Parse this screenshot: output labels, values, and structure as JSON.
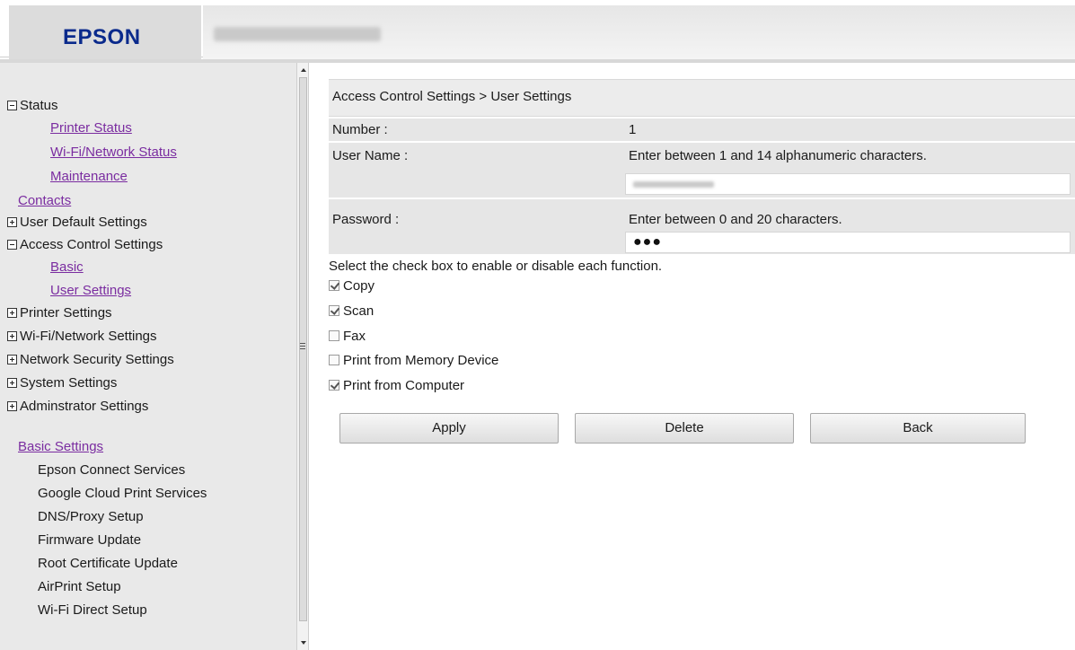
{
  "header": {
    "logo_text": "EPSON"
  },
  "sidebar": {
    "status": "Status",
    "printer_status": "Printer Status",
    "wifi_network_status": "Wi-Fi/Network Status",
    "maintenance": "Maintenance",
    "contacts": "Contacts",
    "user_default_settings": "User Default Settings",
    "access_control_settings": "Access Control Settings",
    "basic": "Basic",
    "user_settings": "User Settings",
    "printer_settings": "Printer Settings",
    "wifi_network_settings": "Wi-Fi/Network Settings",
    "network_security_settings": "Network Security Settings",
    "system_settings": "System Settings",
    "administrator_settings": "Adminstrator Settings",
    "basic_settings": "Basic Settings",
    "epson_connect": "Epson Connect Services",
    "google_cloud_print": "Google Cloud Print Services",
    "dns_proxy": "DNS/Proxy Setup",
    "firmware_update": "Firmware Update",
    "root_cert_update": "Root Certificate Update",
    "airprint_setup": "AirPrint Setup",
    "wifi_direct_setup": "Wi-Fi Direct Setup"
  },
  "main": {
    "breadcrumb": "Access Control Settings > User Settings",
    "number_label": "Number :",
    "number_value": "1",
    "username_label": "User Name :",
    "username_hint": "Enter between 1 and 14 alphanumeric characters.",
    "password_label": "Password :",
    "password_hint": "Enter between 0 and 20 characters.",
    "password_value": "●●●",
    "functions_hint": "Select the check box to enable or disable each function.",
    "functions": [
      {
        "label": "Copy",
        "checked": true
      },
      {
        "label": "Scan",
        "checked": true
      },
      {
        "label": "Fax",
        "checked": false
      },
      {
        "label": "Print from Memory Device",
        "checked": false
      },
      {
        "label": "Print from Computer",
        "checked": true
      }
    ],
    "apply_label": "Apply",
    "delete_label": "Delete",
    "back_label": "Back"
  }
}
